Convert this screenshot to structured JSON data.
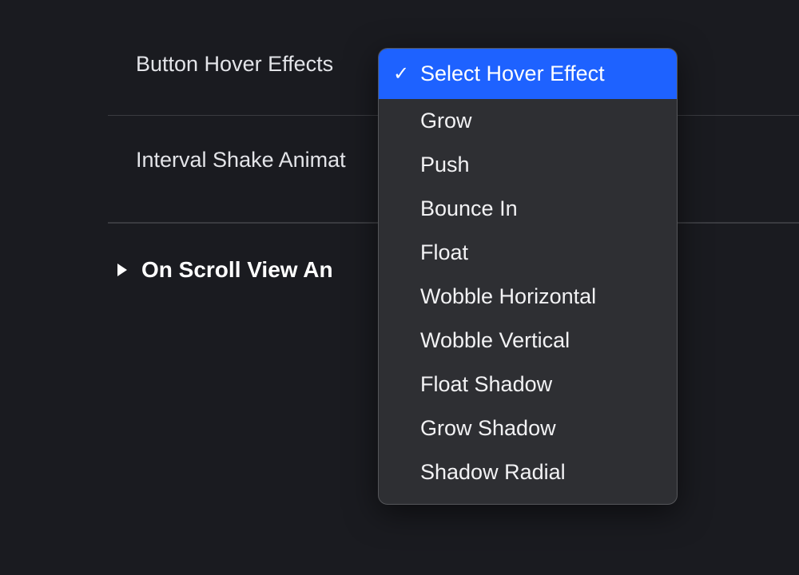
{
  "settings": {
    "row1_label": "Button Hover Effects",
    "row2_label": "Interval Shake Animat",
    "section_label": "On Scroll View An"
  },
  "dropdown": {
    "items": [
      {
        "label": "Select Hover Effect",
        "selected": true
      },
      {
        "label": "Grow",
        "selected": false
      },
      {
        "label": "Push",
        "selected": false
      },
      {
        "label": "Bounce In",
        "selected": false
      },
      {
        "label": "Float",
        "selected": false
      },
      {
        "label": "Wobble Horizontal",
        "selected": false
      },
      {
        "label": "Wobble Vertical",
        "selected": false
      },
      {
        "label": "Float Shadow",
        "selected": false
      },
      {
        "label": "Grow Shadow",
        "selected": false
      },
      {
        "label": "Shadow Radial",
        "selected": false
      }
    ]
  },
  "glyphs": {
    "check": "✓"
  }
}
